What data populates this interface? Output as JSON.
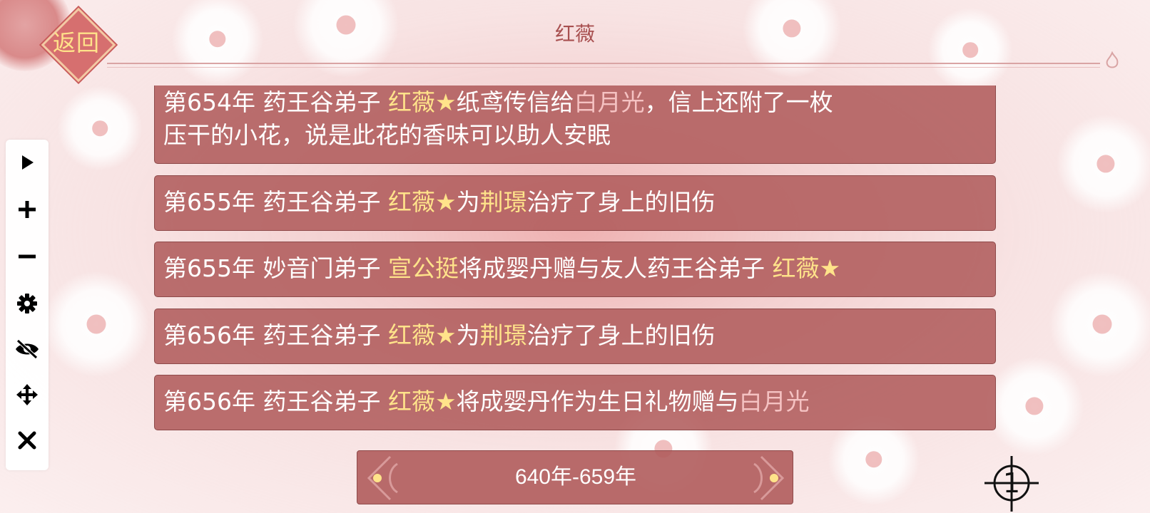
{
  "header": {
    "back_label": "返回",
    "title": "红薇"
  },
  "toolbar": {
    "tools": [
      "play-icon",
      "plus-icon",
      "minus-icon",
      "gear-icon",
      "eye-off-icon",
      "move-icon",
      "close-icon"
    ]
  },
  "events": [
    {
      "line1": [
        {
          "t": "第654年 药王谷弟子 ",
          "c": "w"
        },
        {
          "t": "红薇★",
          "c": "y"
        },
        {
          "t": "纸鸢传信给",
          "c": "w"
        },
        {
          "t": "白月光",
          "c": "p"
        },
        {
          "t": "，信上还附了一枚",
          "c": "w"
        }
      ],
      "line2": [
        {
          "t": "压干的小花，说是此花的香味可以助人安眠",
          "c": "w"
        }
      ]
    },
    {
      "line1": [
        {
          "t": "第655年 药王谷弟子 ",
          "c": "w"
        },
        {
          "t": "红薇★",
          "c": "y"
        },
        {
          "t": "为",
          "c": "w"
        },
        {
          "t": "荆璟",
          "c": "y"
        },
        {
          "t": "治疗了身上的旧伤",
          "c": "w"
        }
      ]
    },
    {
      "line1": [
        {
          "t": "第655年 妙音门弟子 ",
          "c": "w"
        },
        {
          "t": "宣公挺",
          "c": "y"
        },
        {
          "t": "将成婴丹赠与友人药王谷弟子 ",
          "c": "w"
        },
        {
          "t": "红薇★",
          "c": "y"
        }
      ]
    },
    {
      "line1": [
        {
          "t": "第656年 药王谷弟子 ",
          "c": "w"
        },
        {
          "t": "红薇★",
          "c": "y"
        },
        {
          "t": "为",
          "c": "w"
        },
        {
          "t": "荆璟",
          "c": "y"
        },
        {
          "t": "治疗了身上的旧伤",
          "c": "w"
        }
      ]
    },
    {
      "line1": [
        {
          "t": "第656年 药王谷弟子 ",
          "c": "w"
        },
        {
          "t": "红薇★",
          "c": "y"
        },
        {
          "t": "将成婴丹作为生日礼物赠与",
          "c": "w"
        },
        {
          "t": "白月光",
          "c": "p"
        }
      ]
    }
  ],
  "range": {
    "label": "640年-659年"
  },
  "page_marker": {
    "value": "1"
  },
  "colors": {
    "highlight_name": "#ffe38a",
    "highlight_pink": "#f5c2c2",
    "card_bg": "#b05c5c"
  }
}
